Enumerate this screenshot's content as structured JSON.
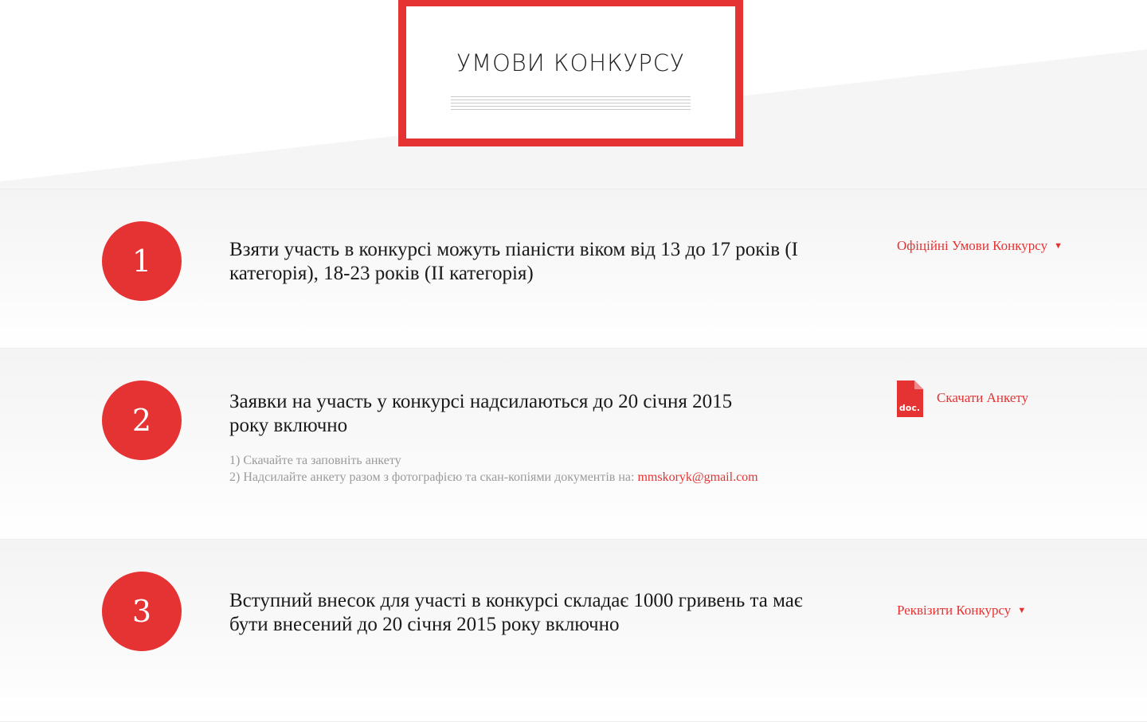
{
  "section": {
    "title": "УМОВИ КОНКУРСУ"
  },
  "colors": {
    "accent": "#e53232",
    "muted_text": "#9a9a9a",
    "row_background": "#f5f5f5"
  },
  "conditions": [
    {
      "number": "1",
      "text": "Взяти участь в конкурсі можуть піаністи віком від 13 до 17 років (I категорія), 18-23 років (II категорія)",
      "link": {
        "label": "Офіційні Умови Конкурсу",
        "icon": "chevron-down-icon"
      }
    },
    {
      "number": "2",
      "text": "Заявки на участь у конкурсі надсилаються до 20 січня 2015 року включно",
      "steps": [
        "1) Скачайте та заповніть анкету",
        "2) Надсилайте анкету разом з фотографією та скан-копіями документів на: "
      ],
      "email": "mmskoryk@gmail.com",
      "download": {
        "label": "Скачати Анкету",
        "icon": "doc-file-icon",
        "icon_text": "doc."
      }
    },
    {
      "number": "3",
      "text": "Вступний внесок для участі в конкурсі складає 1000 гривень та має бути внесений до 20 січня 2015 року включно",
      "link": {
        "label": "Реквізити Конкурсу",
        "icon": "chevron-down-icon"
      }
    }
  ]
}
